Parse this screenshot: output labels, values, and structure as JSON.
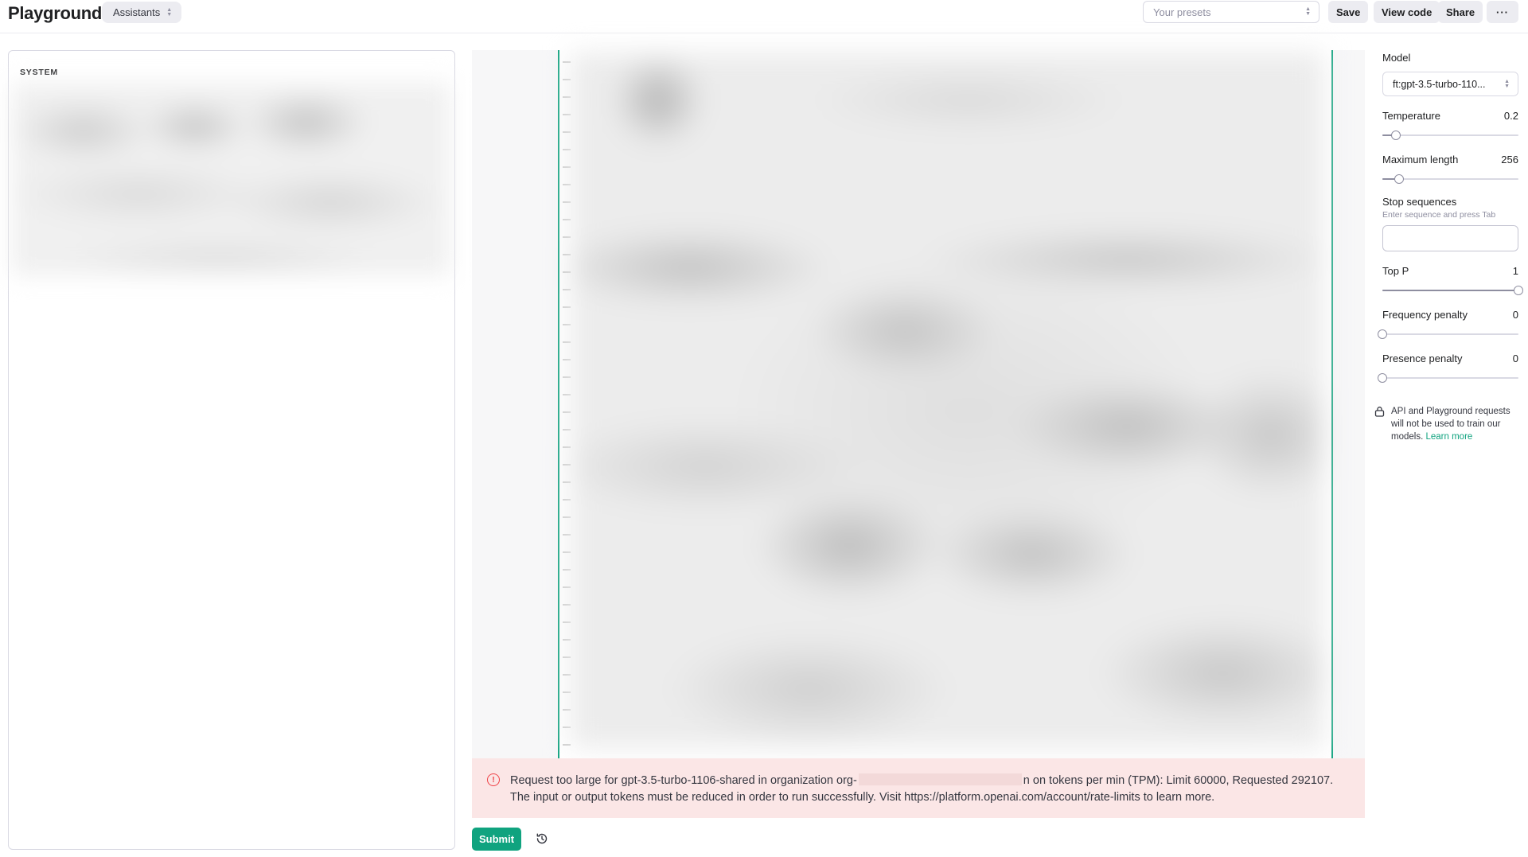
{
  "header": {
    "title": "Playground",
    "mode": "Assistants",
    "presets_placeholder": "Your presets",
    "save": "Save",
    "view_code": "View code",
    "share": "Share",
    "more": "···"
  },
  "system": {
    "label": "SYSTEM"
  },
  "error": {
    "text_before": "Request too large for gpt-3.5-turbo-1106-shared in organization org-",
    "text_after": "n on tokens per min (TPM): Limit 60000, Requested 292107. The input or output tokens must be reduced in order to run successfully. Visit https://platform.openai.com/account/rate-limits to learn more."
  },
  "actions": {
    "submit": "Submit"
  },
  "sidebar": {
    "model_label": "Model",
    "model_value": "ft:gpt-3.5-turbo-110...",
    "temperature": {
      "label": "Temperature",
      "value": "0.2",
      "fraction": 0.1
    },
    "max_length": {
      "label": "Maximum length",
      "value": "256",
      "fraction": 0.125
    },
    "stop_sequences": {
      "label": "Stop sequences",
      "hint": "Enter sequence and press Tab"
    },
    "top_p": {
      "label": "Top P",
      "value": "1",
      "fraction": 1.0
    },
    "frequency_penalty": {
      "label": "Frequency penalty",
      "value": "0",
      "fraction": 0.0
    },
    "presence_penalty": {
      "label": "Presence penalty",
      "value": "0",
      "fraction": 0.0
    },
    "privacy_text": "API and Playground requests will not be used to train our models.",
    "learn_more": "Learn more"
  },
  "colors": {
    "accent": "#10a37f",
    "error_bg": "#fbe6e6",
    "error_icon": "#ef4146"
  }
}
